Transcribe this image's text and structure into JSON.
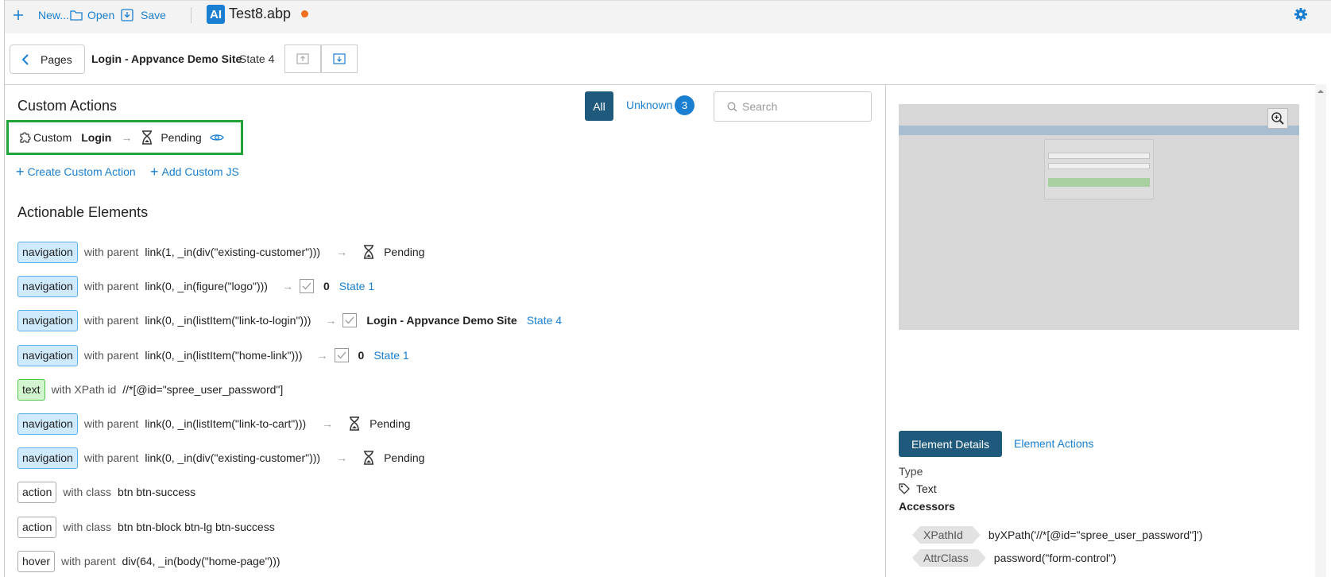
{
  "toolbar": {
    "new_label": "New...",
    "open_label": "Open",
    "save_label": "Save",
    "app_badge": "AI",
    "file_name": "Test8.abp",
    "accent_color": "#1a7fd0",
    "dirty_color": "#f07020"
  },
  "breadcrumb": {
    "pages_label": "Pages",
    "page_title": "Login - Appvance Demo Site",
    "state_label": "State 4"
  },
  "custom_actions": {
    "heading": "Custom Actions",
    "filter_all": "All",
    "filter_unknown": "Unknown",
    "unknown_count": "3",
    "search_placeholder": "Search",
    "item": {
      "type_label": "Custom",
      "name": "Login",
      "status": "Pending"
    },
    "create_label": "Create Custom Action",
    "add_js_label": "Add Custom JS"
  },
  "actionable": {
    "heading": "Actionable Elements",
    "rows": [
      {
        "tag": "navigation",
        "kind": "nav",
        "qualifier": "with parent",
        "selector": "link(1, _in(div(\"existing-customer\")))",
        "status": "Pending"
      },
      {
        "tag": "navigation",
        "kind": "nav",
        "qualifier": "with parent",
        "selector": "link(0, _in(figure(\"logo\")))",
        "count": "0",
        "state": "State 1"
      },
      {
        "tag": "navigation",
        "kind": "nav",
        "qualifier": "with parent",
        "selector": "link(0, _in(listItem(\"link-to-login\")))",
        "target": "Login - Appvance Demo Site",
        "state": "State 4"
      },
      {
        "tag": "navigation",
        "kind": "nav",
        "qualifier": "with parent",
        "selector": "link(0, _in(listItem(\"home-link\")))",
        "count": "0",
        "state": "State 1"
      },
      {
        "tag": "text",
        "kind": "text",
        "qualifier": "with XPath id",
        "selector": "//*[@id=\"spree_user_password\"]"
      },
      {
        "tag": "navigation",
        "kind": "nav",
        "qualifier": "with parent",
        "selector": "link(0, _in(listItem(\"link-to-cart\")))",
        "status": "Pending"
      },
      {
        "tag": "navigation",
        "kind": "nav",
        "qualifier": "with parent",
        "selector": "link(0, _in(div(\"existing-customer\")))",
        "status": "Pending"
      },
      {
        "tag": "action",
        "kind": "action",
        "qualifier": "with class",
        "selector": "btn btn-success"
      },
      {
        "tag": "action",
        "kind": "action",
        "qualifier": "with class",
        "selector": "btn btn-block btn-lg btn-success"
      },
      {
        "tag": "hover",
        "kind": "action",
        "qualifier": "with parent",
        "selector": "div(64, _in(body(\"home-page\")))"
      }
    ]
  },
  "details": {
    "tab_details": "Element Details",
    "tab_actions": "Element Actions",
    "type_label": "Type",
    "type_value": "Text",
    "accessors_label": "Accessors",
    "accessors": [
      {
        "kind": "XPathId",
        "value": "byXPath('//*[@id=\"spree_user_password\"]')"
      },
      {
        "kind": "AttrClass",
        "value": "password(\"form-control\")"
      }
    ]
  }
}
